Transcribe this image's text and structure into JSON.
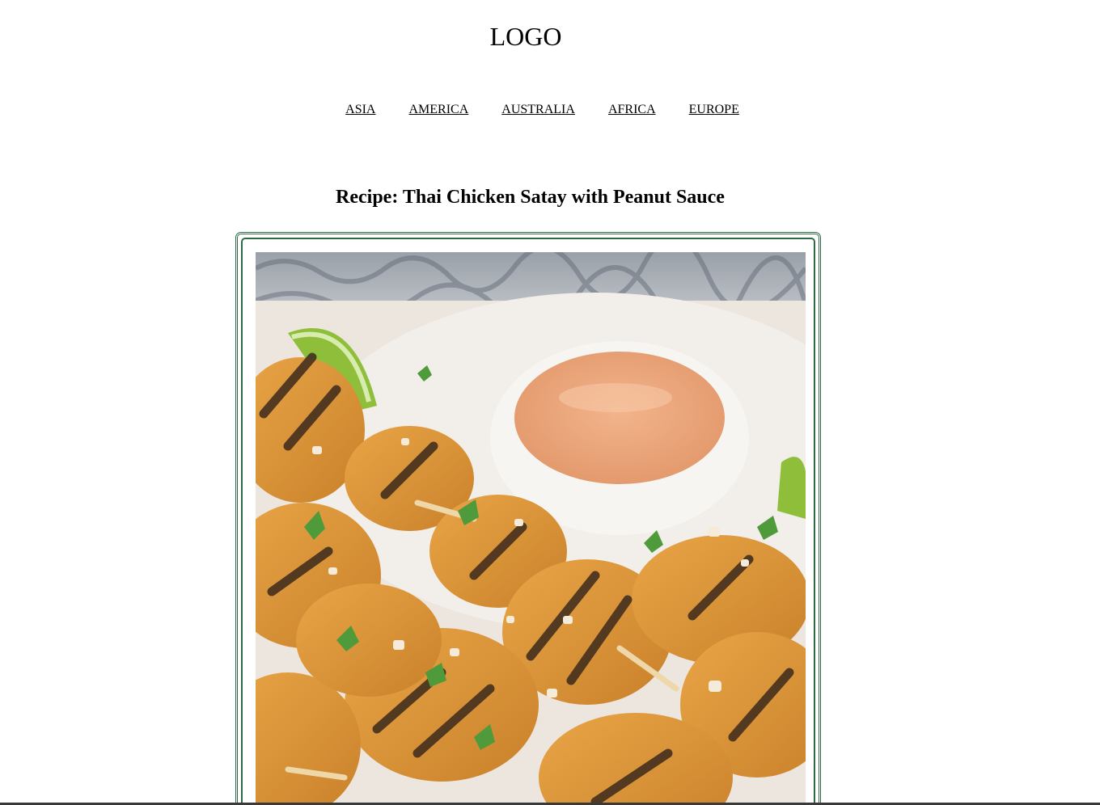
{
  "header": {
    "logo": "LOGO"
  },
  "nav": {
    "items": [
      {
        "label": "ASIA"
      },
      {
        "label": "AMERICA"
      },
      {
        "label": "AUSTRALIA"
      },
      {
        "label": "AFRICA"
      },
      {
        "label": "EUROPE"
      }
    ]
  },
  "recipe": {
    "title": "Recipe: Thai Chicken Satay with Peanut Sauce",
    "image_subject": "grilled chicken satay skewers with peanut dipping sauce",
    "colors": {
      "card_border": "#2e6b45"
    }
  }
}
